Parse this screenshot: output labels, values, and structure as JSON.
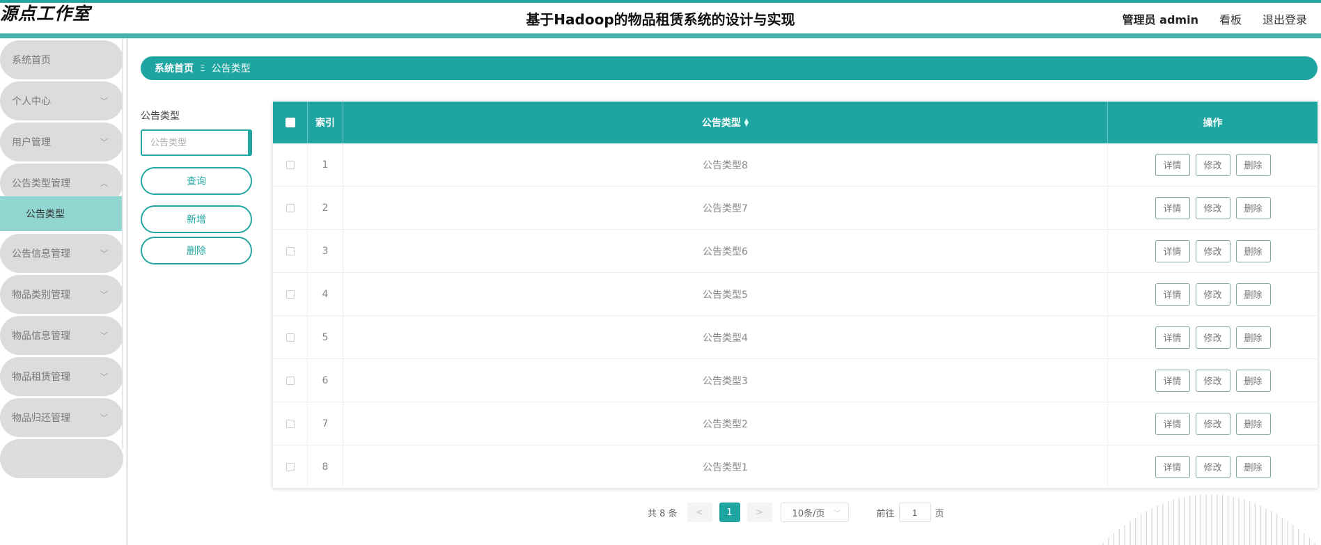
{
  "header": {
    "logo": "源点工作室",
    "title": "基于Hadoop的物品租赁系统的设计与实现",
    "user": "管理员 admin",
    "board": "看板",
    "logout": "退出登录"
  },
  "sidebar": {
    "items": [
      {
        "label": "系统首页",
        "chevron": ""
      },
      {
        "label": "个人中心",
        "chevron": "﹀"
      },
      {
        "label": "用户管理",
        "chevron": "﹀"
      },
      {
        "label": "公告类型管理",
        "chevron": "︿"
      },
      {
        "label": "公告信息管理",
        "chevron": "﹀"
      },
      {
        "label": "物品类别管理",
        "chevron": "﹀"
      },
      {
        "label": "物品信息管理",
        "chevron": "﹀"
      },
      {
        "label": "物品租赁管理",
        "chevron": "﹀"
      },
      {
        "label": "物品归还管理",
        "chevron": "﹀"
      }
    ],
    "sub_item": "公告类型"
  },
  "breadcrumb": {
    "home": "系统首页",
    "separator": "Ξ",
    "current": "公告类型"
  },
  "search": {
    "label": "公告类型",
    "placeholder": "公告类型",
    "query_button": "查询",
    "add_button": "新增",
    "delete_button": "删除"
  },
  "table": {
    "columns": {
      "index": "索引",
      "type": "公告类型",
      "actions": "操作"
    },
    "actions": {
      "detail": "详情",
      "edit": "修改",
      "delete": "删除"
    },
    "rows": [
      {
        "index": "1",
        "type": "公告类型8"
      },
      {
        "index": "2",
        "type": "公告类型7"
      },
      {
        "index": "3",
        "type": "公告类型6"
      },
      {
        "index": "4",
        "type": "公告类型5"
      },
      {
        "index": "5",
        "type": "公告类型4"
      },
      {
        "index": "6",
        "type": "公告类型3"
      },
      {
        "index": "7",
        "type": "公告类型2"
      },
      {
        "index": "8",
        "type": "公告类型1"
      }
    ]
  },
  "pagination": {
    "total": "共 8 条",
    "prev": "<",
    "current": "1",
    "next": ">",
    "page_size": "10条/页",
    "goto_prefix": "前往",
    "goto_value": "1",
    "goto_suffix": "页"
  },
  "colors": {
    "accent": "#1ea5a1",
    "sub_menu": "#92d6d2",
    "action_border": "#7fa88e"
  }
}
